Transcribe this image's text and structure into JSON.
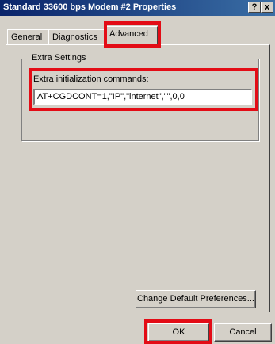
{
  "window": {
    "title": "Standard 33600 bps Modem #2 Properties",
    "help_button": "?",
    "close_button": "x"
  },
  "tabs": [
    {
      "label": "General",
      "active": false
    },
    {
      "label": "Diagnostics",
      "active": false
    },
    {
      "label": "Advanced",
      "active": true
    }
  ],
  "extra_settings": {
    "group_label": "Extra Settings",
    "field_label": "Extra initialization commands:",
    "value": "AT+CGDCONT=1,\"IP\",\"internet\",\"\",0,0"
  },
  "buttons": {
    "change_preferences": "Change Default Preferences...",
    "ok": "OK",
    "cancel": "Cancel"
  },
  "colors": {
    "highlight": "#e30c16",
    "titlebar_start": "#0a246a",
    "titlebar_end": "#3a6ea5",
    "face": "#d4d0c8"
  }
}
